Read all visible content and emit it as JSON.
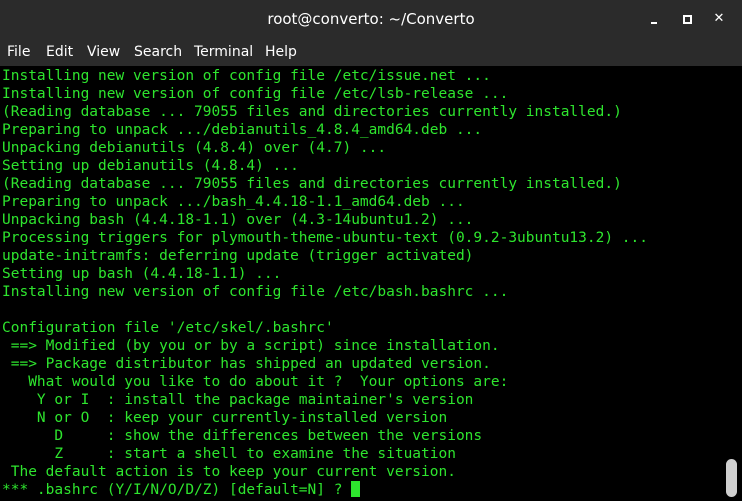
{
  "window": {
    "title": "root@converto: ~/Converto",
    "controls": {
      "minimize_icon": "minimize-icon",
      "maximize_icon": "maximize-icon",
      "close_glyph": "✕"
    }
  },
  "menu": {
    "file": "File",
    "edit": "Edit",
    "view": "View",
    "search": "Search",
    "terminal": "Terminal",
    "help": "Help"
  },
  "colors": {
    "terminal_text": "#2ee52e",
    "terminal_bg": "#000000",
    "chrome_bg": "#2b2b2b"
  },
  "terminal": {
    "lines": [
      "Installing new version of config file /etc/issue.net ...",
      "Installing new version of config file /etc/lsb-release ...",
      "(Reading database ... 79055 files and directories currently installed.)",
      "Preparing to unpack .../debianutils_4.8.4_amd64.deb ...",
      "Unpacking debianutils (4.8.4) over (4.7) ...",
      "Setting up debianutils (4.8.4) ...",
      "(Reading database ... 79055 files and directories currently installed.)",
      "Preparing to unpack .../bash_4.4.18-1.1_amd64.deb ...",
      "Unpacking bash (4.4.18-1.1) over (4.3-14ubuntu1.2) ...",
      "Processing triggers for plymouth-theme-ubuntu-text (0.9.2-3ubuntu13.2) ...",
      "update-initramfs: deferring update (trigger activated)",
      "Setting up bash (4.4.18-1.1) ...",
      "Installing new version of config file /etc/bash.bashrc ...",
      "",
      "Configuration file '/etc/skel/.bashrc'",
      " ==> Modified (by you or by a script) since installation.",
      " ==> Package distributor has shipped an updated version.",
      "   What would you like to do about it ?  Your options are:",
      "    Y or I  : install the package maintainer's version",
      "    N or O  : keep your currently-installed version",
      "      D     : show the differences between the versions",
      "      Z     : start a shell to examine the situation",
      " The default action is to keep your current version.",
      "*** .bashrc (Y/I/N/O/D/Z) [default=N] ? "
    ]
  }
}
